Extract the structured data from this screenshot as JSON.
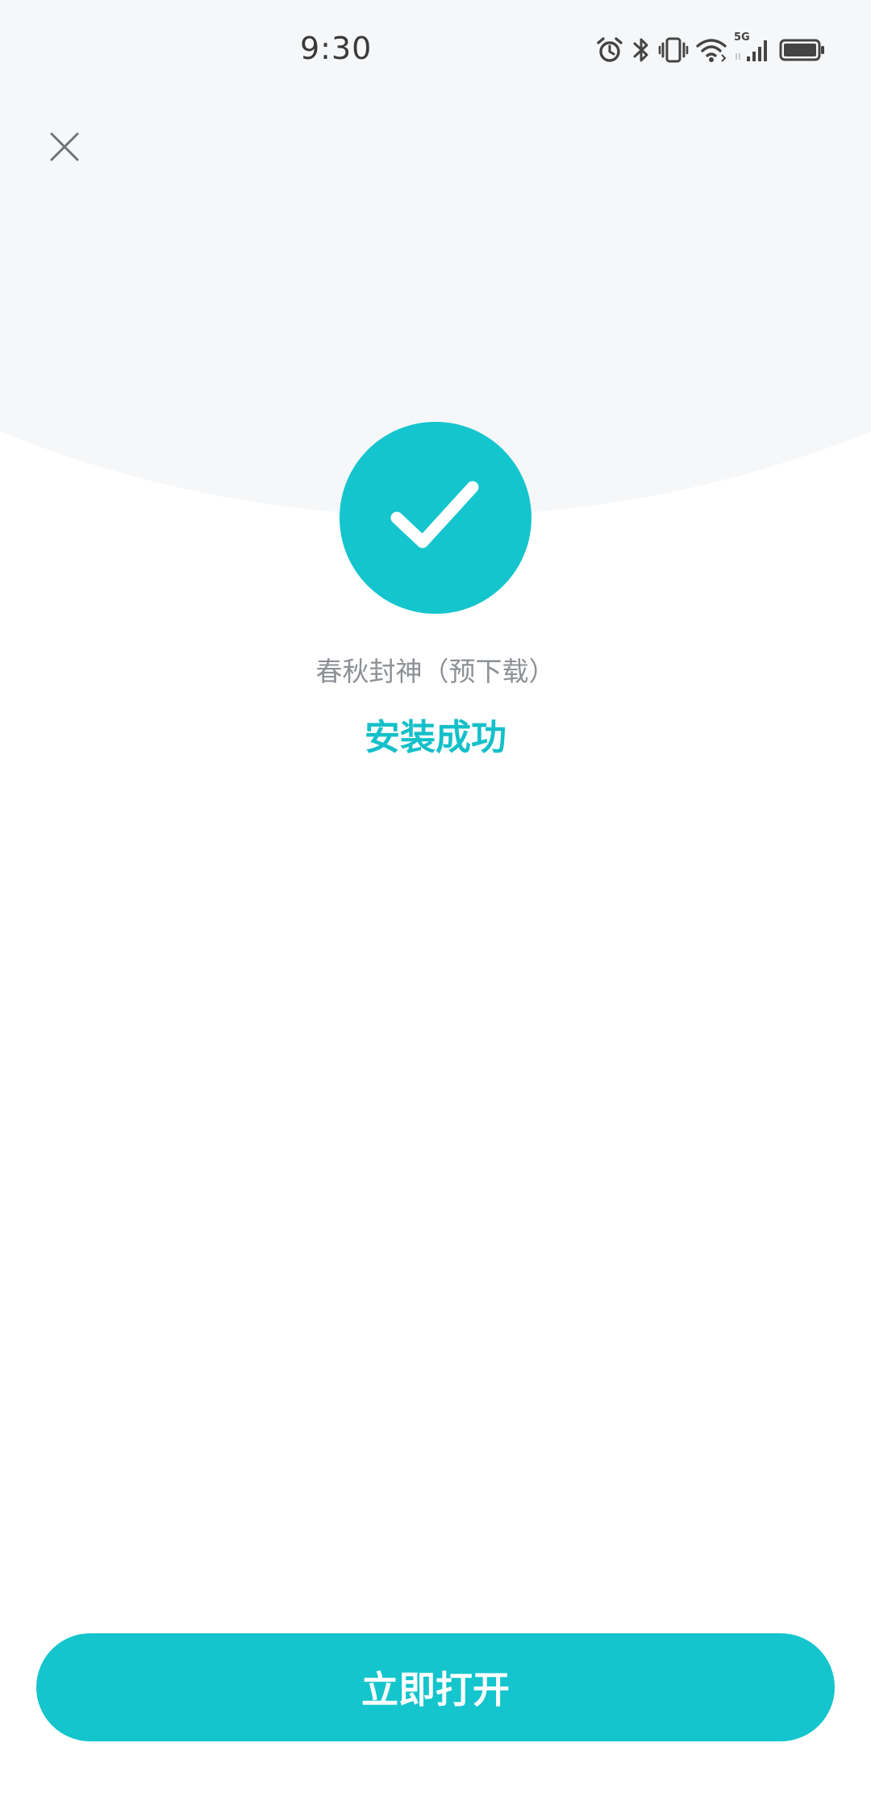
{
  "status_bar": {
    "time": "9:30",
    "network_label": "5G",
    "icons": [
      "alarm-icon",
      "bluetooth-icon",
      "vibrate-icon",
      "wifi-icon",
      "cellular-signal-icon",
      "battery-icon"
    ]
  },
  "dialog": {
    "close_icon": "close-icon",
    "success_icon": "checkmark-icon",
    "app_name": "春秋封神（预下载）",
    "status_text": "安装成功",
    "open_button_label": "立即打开"
  },
  "colors": {
    "accent": "#14c5cd",
    "status_text": "#14c0c9",
    "app_name_text": "#8d9196",
    "top_background": "#f6f7f9",
    "page_background": "#ffffff"
  }
}
